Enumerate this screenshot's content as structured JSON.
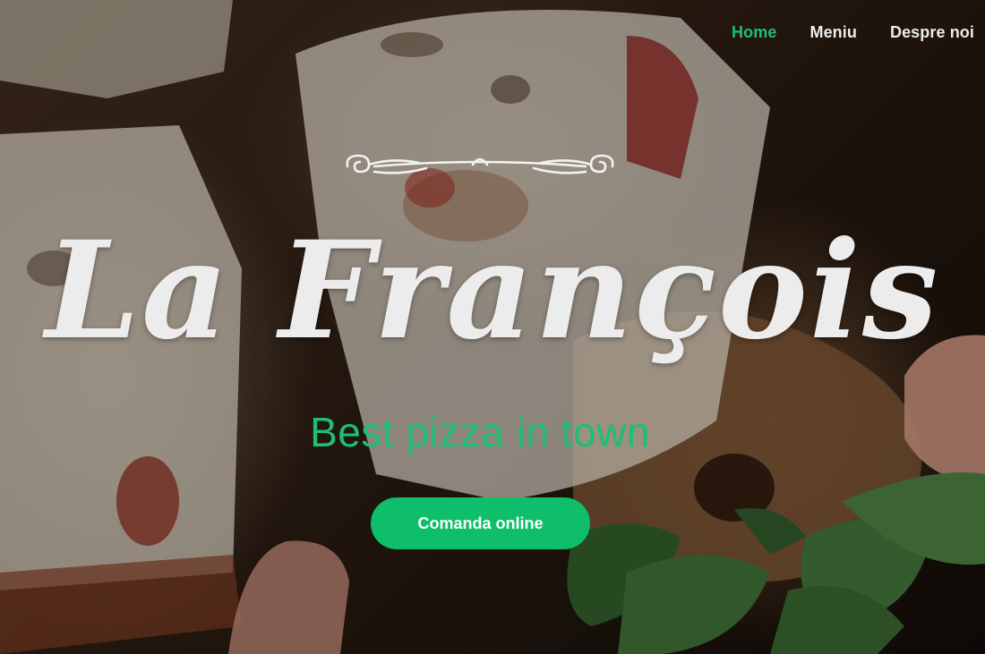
{
  "nav": {
    "items": [
      {
        "label": "Home",
        "active": true
      },
      {
        "label": "Meniu",
        "active": false
      },
      {
        "label": "Despre noi",
        "active": false
      }
    ]
  },
  "hero": {
    "brand": "La François",
    "tagline": "Best pizza in town",
    "cta_label": "Comanda online",
    "background_image": "pizza-slices-photo"
  },
  "colors": {
    "accent": "#1dbf73",
    "button": "#0ebe6a",
    "text_light": "#ececec"
  }
}
